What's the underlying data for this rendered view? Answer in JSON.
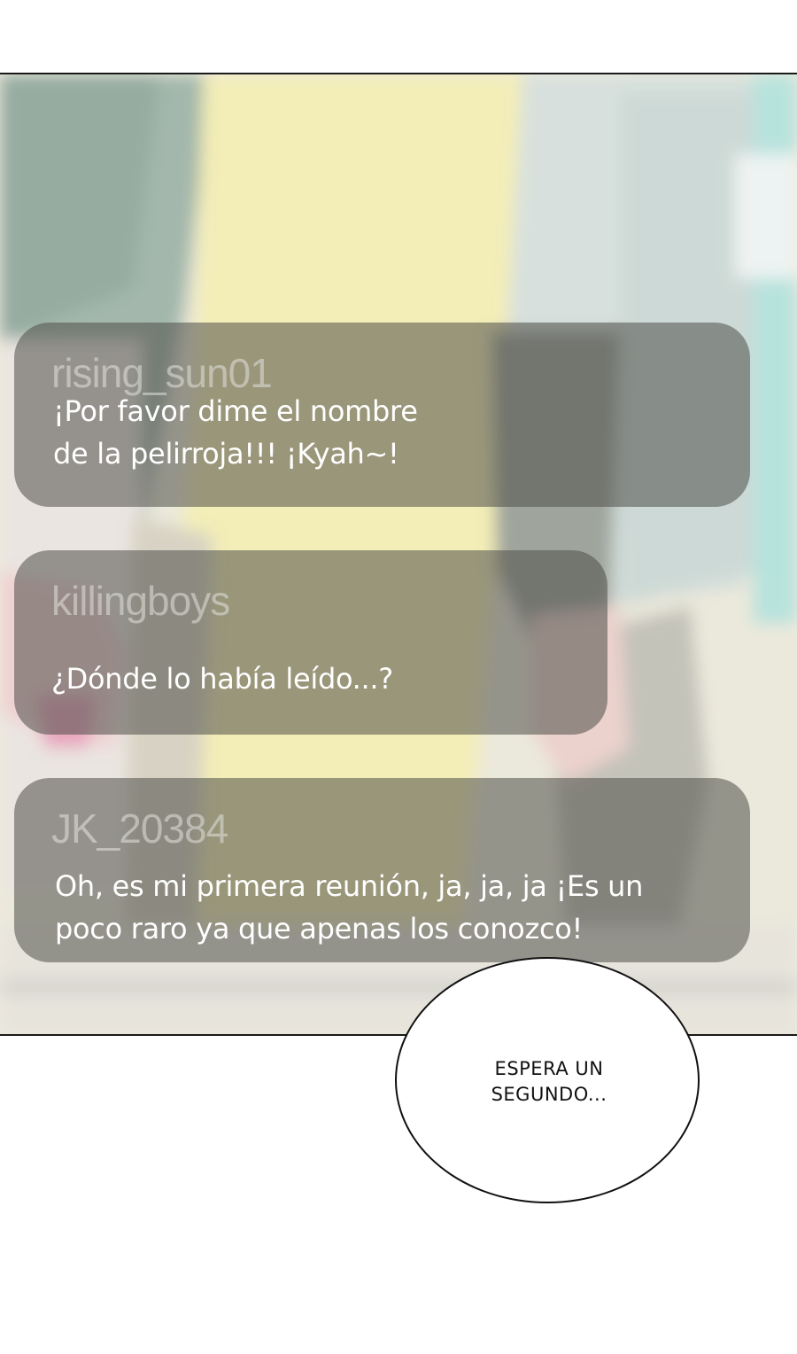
{
  "chat": [
    {
      "username": "rising_sun01",
      "message": "¡Por favor dime el nombre\n de la pelirroja!!! ¡Kyah~!"
    },
    {
      "username": "killingboys",
      "message": "¿Dónde lo había leído...?"
    },
    {
      "username": "JK_20384",
      "message": "Oh, es mi primera reunión, ja, ja, ja ¡Es un\npoco raro ya que apenas los conozco!"
    }
  ],
  "speech_bubble": {
    "text": "ESPERA UN\nSEGUNDO..."
  }
}
